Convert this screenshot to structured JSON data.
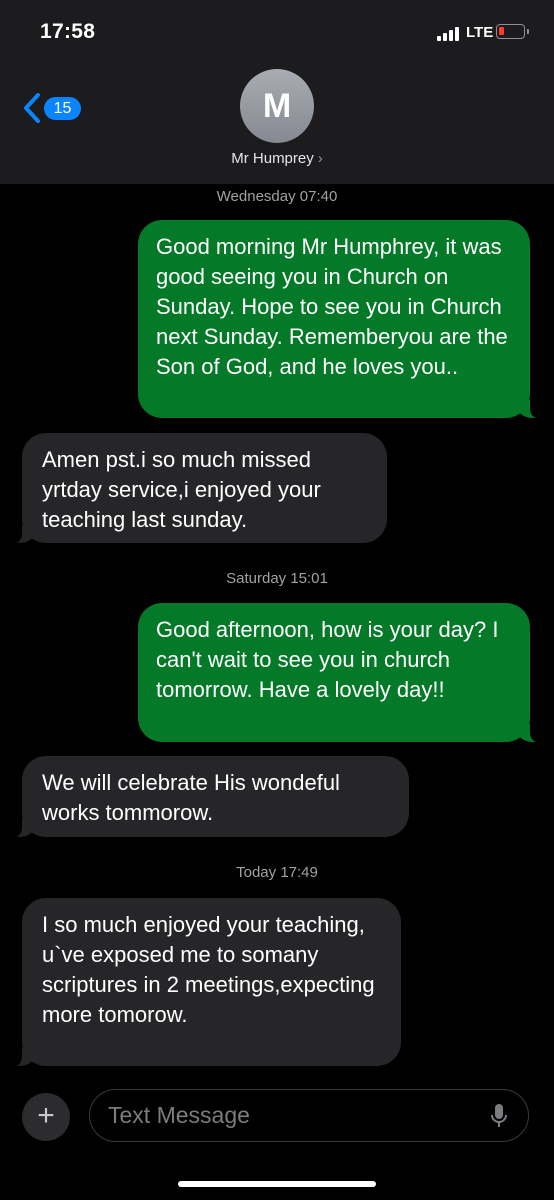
{
  "status_bar": {
    "time": "17:58",
    "network": "LTE",
    "battery_color": "#ff3b30"
  },
  "header": {
    "back_badge": "15",
    "avatar_initial": "M",
    "contact_name": "Mr Humprey",
    "chevron": "›"
  },
  "messages": {
    "stamp_1": "Wednesday 07:40",
    "msg_1": "Good morning Mr Humphrey, it was good seeing you in Church on Sunday.  Hope to see you in Church next Sunday. Rememberyou are the Son of God, and he loves you..",
    "msg_2": "Amen pst.i so much missed yrtday service,i enjoyed your teaching last sunday.",
    "stamp_2": "Saturday 15:01",
    "msg_3": "Good afternoon, how is your day? I can't wait to see you in church tomorrow. Have a lovely day!!",
    "msg_4": "We will celebrate His wondeful works tommorow.",
    "stamp_3": "Today 17:49",
    "msg_5": "I so much enjoyed your teaching, u`ve exposed me to somany scriptures in 2 meetings,expecting more tomorow."
  },
  "composer": {
    "placeholder": "Text Message",
    "plus": "+"
  },
  "colors": {
    "sent_bubble": "#047a29",
    "received_bubble": "#262629",
    "accent": "#0a84ff"
  },
  "icons": [
    "back-chevron-icon",
    "plus-icon",
    "microphone-icon",
    "signal-icon",
    "battery-icon"
  ]
}
